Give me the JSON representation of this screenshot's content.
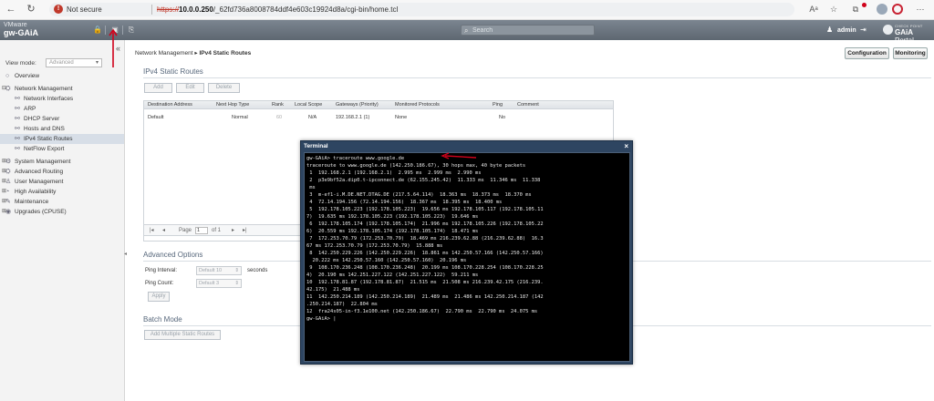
{
  "browser": {
    "security_label": "Not secure",
    "url_protocol": "https://",
    "url_host": "10.0.0.250",
    "url_path": "/_62fd736a8008784ddf4e603c19924d8a/cgi-bin/home.tcl"
  },
  "header": {
    "brand_top": "VMware",
    "brand_name": "gw-GAiA",
    "search_placeholder": "Search",
    "user": "admin",
    "logo_small": "CHECK POINT",
    "logo_main": "GAiA",
    "logo_sub": " Portal"
  },
  "sidebar": {
    "collapse_glyph": "«",
    "view_mode_label": "View mode:",
    "view_mode_value": "Advanced",
    "items": [
      {
        "label": "Overview",
        "icon": "○",
        "level": 0
      },
      {
        "label": "Network Management",
        "icon": "⛭",
        "level": 0,
        "expander": "⊟"
      },
      {
        "label": "Network Interfaces",
        "icon": "⚯",
        "level": 1
      },
      {
        "label": "ARP",
        "icon": "⚯",
        "level": 1
      },
      {
        "label": "DHCP Server",
        "icon": "⚯",
        "level": 1
      },
      {
        "label": "Hosts and DNS",
        "icon": "⚯",
        "level": 1
      },
      {
        "label": "IPv4 Static Routes",
        "icon": "⚯",
        "level": 1,
        "selected": true
      },
      {
        "label": "NetFlow Export",
        "icon": "⚯",
        "level": 1
      },
      {
        "label": "System Management",
        "icon": "⚙",
        "level": 0,
        "expander": "⊞"
      },
      {
        "label": "Advanced Routing",
        "icon": "⛭",
        "level": 0,
        "expander": "⊞"
      },
      {
        "label": "User Management",
        "icon": "♙",
        "level": 0,
        "expander": "⊞"
      },
      {
        "label": "High Availability",
        "icon": "◔",
        "level": 0,
        "expander": "⊞"
      },
      {
        "label": "Maintenance",
        "icon": "✎",
        "level": 0,
        "expander": "⊞"
      },
      {
        "label": "Upgrades (CPUSE)",
        "icon": "◉",
        "level": 0,
        "expander": "⊞"
      }
    ]
  },
  "main": {
    "breadcrumb_parent": "Network Management",
    "breadcrumb_sep": "▸",
    "breadcrumb_current": "IPv4 Static Routes",
    "configuration_button": "Configuration",
    "monitoring_button": "Monitoring",
    "static_routes_title": "IPv4 Static Routes",
    "toolbar": {
      "add": "Add",
      "edit": "Edit",
      "delete": "Delete"
    },
    "table": {
      "columns": [
        "Destination Address",
        "Next Hop Type",
        "Rank",
        "Local Scope",
        "Gateways (Priority)",
        "Monitored Protocols",
        "Ping",
        "Comment"
      ],
      "rows": [
        [
          "Default",
          "Normal",
          "60",
          "N/A",
          "192.168.2.1 (1)",
          "None",
          "No",
          ""
        ]
      ]
    },
    "pager": {
      "page_label": "Page",
      "page_value": "1",
      "of_label": "of 1"
    },
    "advanced_title": "Advanced Options",
    "ping_interval_label": "Ping Interval:",
    "ping_interval_value": "Default 10",
    "seconds_label": "seconds",
    "ping_count_label": "Ping Count:",
    "ping_count_value": "Default 3",
    "apply_button": "Apply",
    "batch_title": "Batch Mode",
    "batch_button": "Add Multiple Static Routes"
  },
  "terminal": {
    "title": "Terminal",
    "close": "×",
    "lines": [
      "gw-GAiA> traceroute www.google.de",
      "traceroute to www.google.de (142.250.186.67), 30 hops max, 40 byte packets",
      " 1  192.168.2.1 (192.168.2.1)  2.995 ms  2.999 ms  2.990 ms",
      " 2  p3e9bf52a.dip0.t-ipconnect.de (62.155.245.42)  11.333 ms  11.346 ms  11.338",
      " ms",
      " 3  m-ef1-i.M.DE.NET.DTAG.DE (217.5.64.114)  18.363 ms  18.373 ms  18.370 ms",
      " 4  72.14.194.156 (72.14.194.156)  18.367 ms  18.395 ms  18.400 ms",
      " 5  192.178.105.223 (192.178.105.223)  19.656 ms 192.178.105.117 (192.178.105.11",
      "7)  19.635 ms 192.178.105.223 (192.178.105.223)  19.646 ms",
      " 6  192.178.105.174 (192.178.105.174)  21.996 ms 192.178.105.226 (192.178.105.22",
      "6)  20.559 ms 192.178.105.174 (192.178.105.174)  18.471 ms",
      " 7  172.253.70.79 (172.253.70.79)  18.469 ms 216.239.62.88 (216.239.62.88)  16.3",
      "67 ms 172.253.70.79 (172.253.70.79)  15.888 ms",
      " 8  142.250.229.226 (142.250.229.226)  18.861 ms 142.250.57.166 (142.250.57.166)",
      "  20.222 ms 142.250.57.160 (142.250.57.160)  20.196 ms",
      " 9  108.170.236.248 (108.170.236.248)  20.199 ms 108.170.228.254 (108.170.228.25",
      "4)  20.190 ms 142.251.227.122 (142.251.227.122)  59.211 ms",
      "10  192.178.81.87 (192.178.81.87)  21.515 ms  21.508 ms 216.239.42.175 (216.239.",
      "42.175)  21.488 ms",
      "11  142.250.214.189 (142.250.214.189)  21.489 ms  21.486 ms 142.250.214.187 (142",
      ".250.214.187)  22.804 ms",
      "12  fra24s05-in-f3.1e100.net (142.250.186.67)  22.790 ms  22.790 ms  24.075 ms",
      "gw-GAiA> |"
    ]
  },
  "icons": {
    "back": "←",
    "refresh": "↻",
    "warning": "!",
    "read_aloud": "Aᵃ",
    "favorite": "☆",
    "collections": "⧉",
    "settings": "⋯",
    "lock": "🔒",
    "terminal": "▣",
    "scratchpad": "⎘",
    "search": "⌕",
    "user": "♟",
    "logout": "⇥",
    "pager_first": "|◂",
    "pager_prev": "◂",
    "pager_next": "▸",
    "pager_last": "▸|",
    "spin": "⇕",
    "splitter": "◂"
  },
  "colors": {
    "topbar": "#6b747e",
    "terminal_frame": "#2e4561",
    "annotation": "#d0021b",
    "selected_nav": "#d7dee7"
  }
}
